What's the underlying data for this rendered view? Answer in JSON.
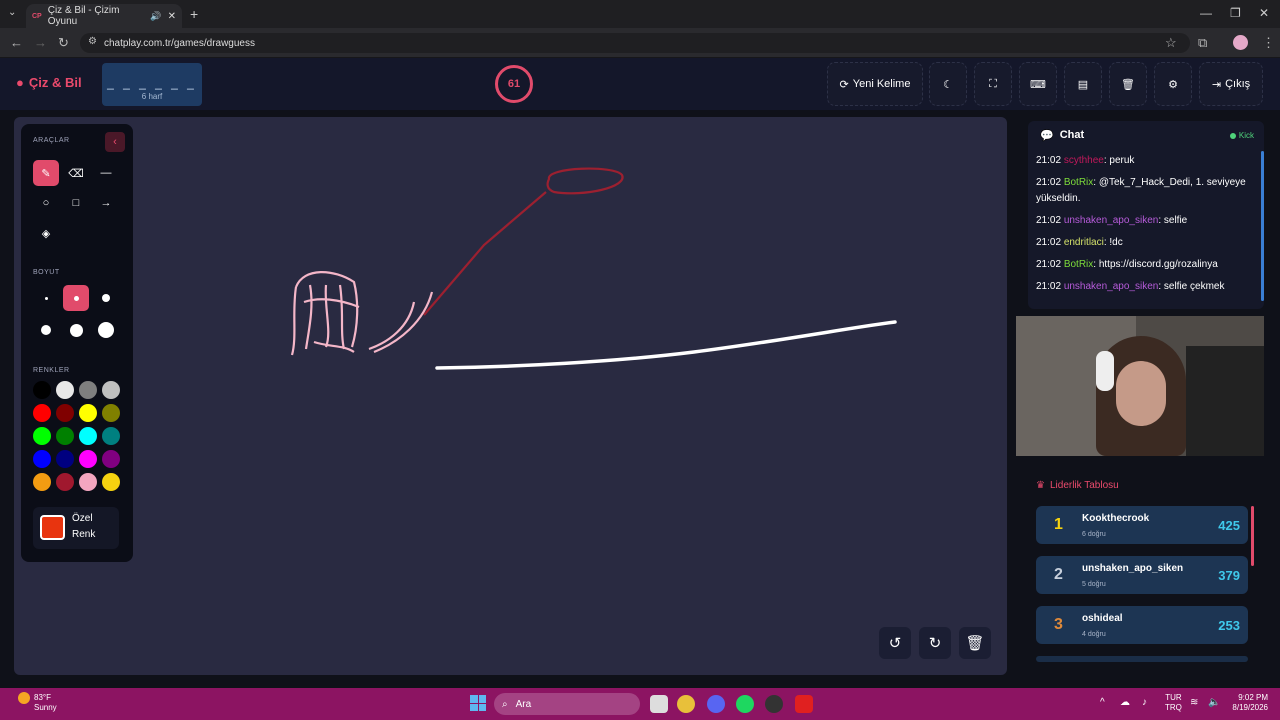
{
  "browser": {
    "tab_title": "Çiz & Bil - Çizim Oyunu",
    "tab_favicon": "CP",
    "url": "chatplay.com.tr/games/drawguess"
  },
  "header": {
    "logo": "Çiz & Bil",
    "word_blanks": "_ _ _ _ _ _",
    "word_hint": "6 harf",
    "timer": "61",
    "new_word": "Yeni Kelime",
    "exit": "Çıkış"
  },
  "tools": {
    "title": "ARAÇLAR",
    "size_title": "BOYUT",
    "colors_title": "RENKLER",
    "custom_color_label": "Özel Renk",
    "custom_color": "#e8340f",
    "colors": [
      "#000000",
      "#e8e8e8",
      "#7f7f7f",
      "#c0c0c0",
      "#ff0000",
      "#800000",
      "#ffff00",
      "#808000",
      "#00ff00",
      "#008000",
      "#00ffff",
      "#008080",
      "#0000ff",
      "#000080",
      "#ff00ff",
      "#800080",
      "#f39c12",
      "#a0182e",
      "#f4a6c0",
      "#f5d210"
    ]
  },
  "chat": {
    "title": "Chat",
    "platform": "Kick",
    "messages": [
      {
        "time": "21:02",
        "user": "scythhee",
        "color": "#c2185b",
        "text": ": peruk"
      },
      {
        "time": "21:02",
        "user": "BotRix",
        "color": "#7ddc3a",
        "text": ": @Tek_7_Hack_Dedi, 1. seviyeye yükseldin."
      },
      {
        "time": "21:02",
        "user": "unshaken_apo_siken",
        "color": "#b65bd9",
        "text": ": selfie"
      },
      {
        "time": "21:02",
        "user": "endritlaci",
        "color": "#d4e26a",
        "text": ": !dc"
      },
      {
        "time": "21:02",
        "user": "BotRix",
        "color": "#7ddc3a",
        "text": ": https://discord.gg/rozalinya"
      },
      {
        "time": "21:02",
        "user": "unshaken_apo_siken",
        "color": "#b65bd9",
        "text": ": selfie çekmek"
      }
    ]
  },
  "leaderboard": {
    "title": "Liderlik Tablosu",
    "rows": [
      {
        "rank": "1",
        "name": "Kookthecrook",
        "sub": "6 doğru",
        "score": "425",
        "rank_color": "#f5d210"
      },
      {
        "rank": "2",
        "name": "unshaken_apo_siken",
        "sub": "5 doğru",
        "score": "379",
        "rank_color": "#c8d0dc"
      },
      {
        "rank": "3",
        "name": "oshideal",
        "sub": "4 doğru",
        "score": "253",
        "rank_color": "#e08a3a"
      }
    ]
  },
  "taskbar": {
    "temp": "83°F",
    "weather": "Sunny",
    "search": "Ara",
    "lang1": "TUR",
    "lang2": "TRQ",
    "time": "9:02 PM",
    "date": "8/19/2026"
  }
}
